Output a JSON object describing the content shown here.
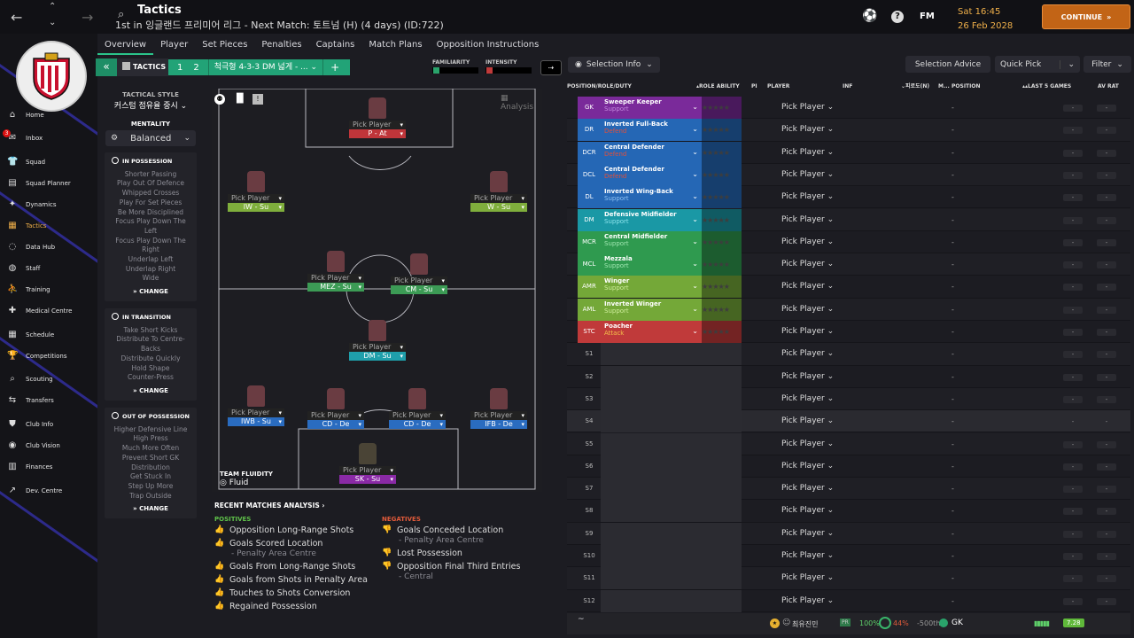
{
  "topbar": {
    "title": "Tactics",
    "subtitle": "1st in 잉글랜드 프리미어 리그 - Next Match: 토트넘 (H) (4 days) (ID:722)",
    "fm_label": "FM",
    "day_time": "Sat 16:45",
    "date": "26 Feb 2028",
    "continue_label": "CONTINUE"
  },
  "sidebar": {
    "items": [
      {
        "label": "Home",
        "icon": "home-icon"
      },
      {
        "label": "Inbox",
        "icon": "inbox-icon",
        "badge": "3"
      },
      {
        "label": "Squad",
        "icon": "shirt-icon"
      },
      {
        "label": "Squad Planner",
        "icon": "planner-icon"
      },
      {
        "label": "Dynamics",
        "icon": "dynamics-icon"
      },
      {
        "label": "Tactics",
        "icon": "tactics-icon",
        "active": true
      },
      {
        "label": "Data Hub",
        "icon": "data-hub-icon"
      },
      {
        "label": "Staff",
        "icon": "staff-icon"
      },
      {
        "label": "Training",
        "icon": "training-icon"
      },
      {
        "label": "Medical Centre",
        "icon": "medical-icon"
      },
      {
        "label": "Schedule",
        "icon": "calendar-icon"
      },
      {
        "label": "Competitions",
        "icon": "trophy-icon"
      },
      {
        "label": "Scouting",
        "icon": "scouting-icon"
      },
      {
        "label": "Transfers",
        "icon": "transfers-icon"
      },
      {
        "label": "Club Info",
        "icon": "club-info-icon"
      },
      {
        "label": "Club Vision",
        "icon": "vision-icon"
      },
      {
        "label": "Finances",
        "icon": "finances-icon"
      },
      {
        "label": "Dev. Centre",
        "icon": "dev-centre-icon"
      }
    ]
  },
  "tabs": [
    "Overview",
    "Player",
    "Set Pieces",
    "Penalties",
    "Captains",
    "Match Plans",
    "Opposition Instructions"
  ],
  "tactic_bar": {
    "label": "TACTICS",
    "slot1": "1",
    "slot2": "2",
    "tactic_name": "척극형 4-3-3 DM 넓게 - ...",
    "add": "+",
    "familiarity_label": "FAMILIARITY",
    "intensity_label": "INTENSITY",
    "selection_info": "Selection Info"
  },
  "left": {
    "tactical_style_label": "TACTICAL STYLE",
    "tactical_style_value": "커스텀 점유율 중시",
    "mentality_label": "MENTALITY",
    "mentality_value": "Balanced",
    "in_possession": {
      "title": "IN POSSESSION",
      "items": [
        "Shorter Passing",
        "Play Out Of Defence",
        "Whipped Crosses",
        "Play For Set Pieces",
        "Be More Disciplined",
        "Focus Play Down The Left",
        "Focus Play Down The Right",
        "Underlap Left",
        "Underlap Right",
        "Wide"
      ],
      "change": "CHANGE"
    },
    "in_transition": {
      "title": "IN TRANSITION",
      "items": [
        "Take Short Kicks",
        "Distribute To Centre-Backs",
        "Distribute Quickly",
        "Hold Shape",
        "Counter-Press"
      ],
      "change": "CHANGE"
    },
    "out_of_possession": {
      "title": "OUT OF POSSESSION",
      "items": [
        "Higher Defensive Line",
        "High Press",
        "Much More Often",
        "Prevent Short GK Distribution",
        "Get Stuck In",
        "Step Up More",
        "Trap Outside"
      ],
      "change": "CHANGE"
    }
  },
  "pitch": {
    "analysis_label": "Analysis",
    "team_fluidity_label": "TEAM FLUIDITY",
    "team_fluidity_value": "Fluid",
    "pick_label": "Pick Player",
    "players": [
      {
        "pos": "P - At",
        "color": "#c0353a"
      },
      {
        "pos": "IW - Su",
        "color": "#7fae3c"
      },
      {
        "pos": "W - Su",
        "color": "#7fae3c"
      },
      {
        "pos": "MEZ - Su",
        "color": "#3c9b55"
      },
      {
        "pos": "CM - Su",
        "color": "#3c9b55"
      },
      {
        "pos": "DM - Su",
        "color": "#1f9fab"
      },
      {
        "pos": "IWB - Su",
        "color": "#2a6cc0"
      },
      {
        "pos": "CD - De",
        "color": "#2a6cc0"
      },
      {
        "pos": "CD - De",
        "color": "#2a6cc0"
      },
      {
        "pos": "IFB - De",
        "color": "#2a6cc0"
      },
      {
        "pos": "SK - Su",
        "color": "#8a2aa6"
      }
    ]
  },
  "analysis": {
    "title": "RECENT MATCHES ANALYSIS",
    "positives_label": "POSITIVES",
    "positives": [
      {
        "text": "Opposition Long-Range Shots"
      },
      {
        "text": "Goals Scored Location",
        "sub": "- Penalty Area Centre"
      },
      {
        "text": "Goals From Long-Range Shots"
      },
      {
        "text": "Goals from Shots in Penalty Area"
      },
      {
        "text": "Touches to Shots Conversion"
      },
      {
        "text": "Regained Possession"
      }
    ],
    "negatives_label": "NEGATIVES",
    "negatives": [
      {
        "text": "Goals Conceded Location",
        "sub": "- Penalty Area Centre"
      },
      {
        "text": "Lost Possession"
      },
      {
        "text": "Opposition Final Third Entries",
        "sub": "- Central"
      }
    ]
  },
  "right": {
    "buttons": {
      "selection_advice": "Selection Advice",
      "quick_pick": "Quick Pick",
      "filter": "Filter"
    },
    "headers": {
      "position": "POSITION/ROLE/DUTY",
      "role_ability": "ROLE ABILITY",
      "pi": "PI",
      "player": "PLAYER",
      "inf": "INF",
      "col_kr": "피로도(N)",
      "m": "M...",
      "position2": "POSITION",
      "last5": "LAST 5 GAMES",
      "avrat": "AV RAT"
    },
    "pick_label": "Pick Player",
    "dash": "-",
    "rows": [
      {
        "pos": "GK",
        "role": "Sweeper Keeper",
        "duty": "Support",
        "color": "#7a2a9a",
        "duty_color": "#c58ae0"
      },
      {
        "pos": "DR",
        "role": "Inverted Full-Back",
        "duty": "Defend",
        "color": "#2567b5",
        "duty_color": "#e0503c"
      },
      {
        "pos": "DCR",
        "role": "Central Defender",
        "duty": "Defend",
        "color": "#2567b5",
        "duty_color": "#e0503c"
      },
      {
        "pos": "DCL",
        "role": "Central Defender",
        "duty": "Defend",
        "color": "#2567b5",
        "duty_color": "#e0503c"
      },
      {
        "pos": "DL",
        "role": "Inverted Wing-Back",
        "duty": "Support",
        "color": "#2567b5",
        "duty_color": "#8fc3f5"
      },
      {
        "pos": "DM",
        "role": "Defensive Midfielder",
        "duty": "Support",
        "color": "#1a98a5",
        "duty_color": "#8be3ec"
      },
      {
        "pos": "MCR",
        "role": "Central Midfielder",
        "duty": "Support",
        "color": "#2f9a4f",
        "duty_color": "#9fe6b0"
      },
      {
        "pos": "MCL",
        "role": "Mezzala",
        "duty": "Support",
        "color": "#2f9a4f",
        "duty_color": "#9fe6b0"
      },
      {
        "pos": "AMR",
        "role": "Winger",
        "duty": "Support",
        "color": "#74a838",
        "duty_color": "#cfee9c"
      },
      {
        "pos": "AML",
        "role": "Inverted Winger",
        "duty": "Support",
        "color": "#74a838",
        "duty_color": "#cfee9c"
      },
      {
        "pos": "STC",
        "role": "Poacher",
        "duty": "Attack",
        "color": "#c03a3a",
        "duty_color": "#f4c04a"
      },
      {
        "pos": "S1"
      },
      {
        "pos": "S2"
      },
      {
        "pos": "S3"
      },
      {
        "pos": "S4"
      },
      {
        "pos": "S5"
      },
      {
        "pos": "S6"
      },
      {
        "pos": "S7"
      },
      {
        "pos": "S8"
      },
      {
        "pos": "S9"
      },
      {
        "pos": "S10"
      },
      {
        "pos": "S11"
      },
      {
        "pos": "S12"
      }
    ],
    "bottom": {
      "name": "최유진민",
      "pr": "PR",
      "pct": "100%",
      "pct2": "44%",
      "rank": "-500th",
      "pos": "GK",
      "rating": "7.28",
      "tilde": "~"
    }
  }
}
